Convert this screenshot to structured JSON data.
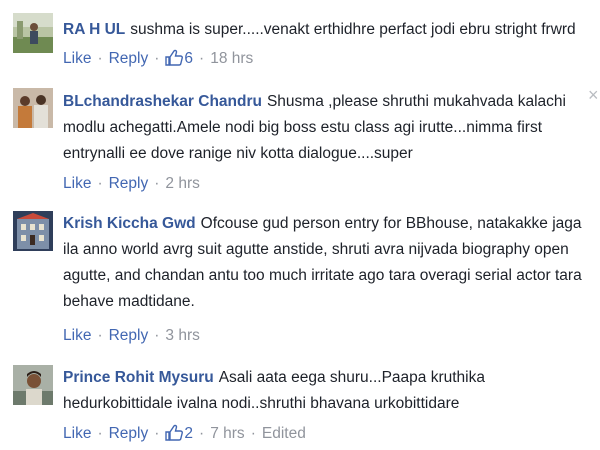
{
  "comments": [
    {
      "author": "RA H UL",
      "text": "sushma is super.....venakt erthidhre perfact jodi ebru stright frwrd",
      "like_label": "Like",
      "reply_label": "Reply",
      "like_count": "6",
      "time": "18 hrs",
      "edited": "",
      "avatar_icon": "user-avatar-outdoor"
    },
    {
      "author": "BLchandrashekar Chandru",
      "text": "Shusma ,please shruthi mukahvada kalachi modlu achegatti.Amele nodi big boss estu class agi irutte...nimma first entrynalli ee dove ranige niv kotta dialogue....super",
      "like_label": "Like",
      "reply_label": "Reply",
      "like_count": "",
      "time": "2 hrs",
      "edited": "",
      "avatar_icon": "user-avatar-couple"
    },
    {
      "author": "Krish Kiccha Gwd",
      "text": "Ofcouse gud person entry for BBhouse, natakakke jaga ila anno world avrg suit agutte anstide, shruti avra nijvada biography open agutte, and chandan antu too much irritate ago tara overagi serial actor tara behave madtidane.",
      "like_label": "Like",
      "reply_label": "Reply",
      "like_count": "",
      "time": "3 hrs",
      "edited": "",
      "avatar_icon": "user-avatar-building"
    },
    {
      "author": "Prince Rohit Mysuru",
      "text": "Asali aata eega shuru...Paapa kruthika hedurkobittidale ivalna nodi..shruthi bhavana urkobittidare",
      "like_label": "Like",
      "reply_label": "Reply",
      "like_count": "2",
      "time": "7 hrs",
      "edited": "Edited",
      "avatar_icon": "user-avatar-portrait"
    }
  ],
  "close_glyph": "×",
  "separator": "·"
}
